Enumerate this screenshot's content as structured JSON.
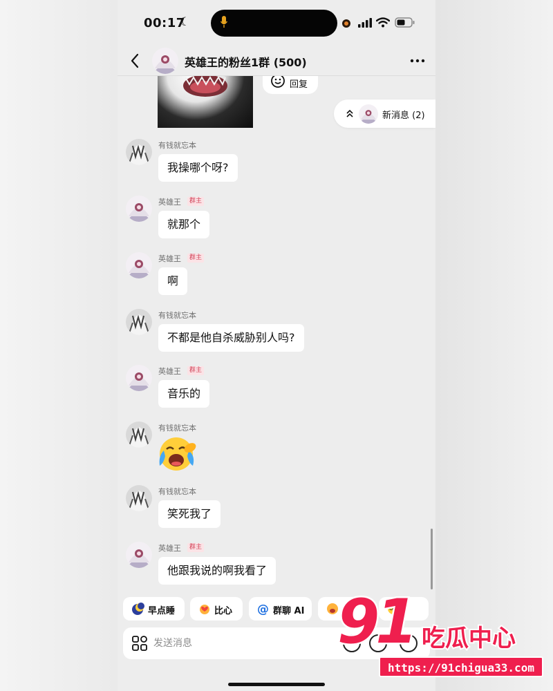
{
  "status_bar": {
    "time": "00:17"
  },
  "header": {
    "title": "英雄王的粉丝1群 (500)"
  },
  "reply_chip": {
    "label": "回复"
  },
  "new_messages": {
    "label": "新消息 (2)"
  },
  "messages": [
    {
      "sender": "有钱就忘本",
      "badge": "",
      "text": "我操哪个呀?"
    },
    {
      "sender": "英雄王",
      "badge": "群主",
      "text": "就那个"
    },
    {
      "sender": "英雄王",
      "badge": "群主",
      "text": "啊"
    },
    {
      "sender": "有钱就忘本",
      "badge": "",
      "text": "不都是他自杀威胁别人吗?"
    },
    {
      "sender": "英雄王",
      "badge": "群主",
      "text": "音乐的"
    },
    {
      "sender": "有钱就忘本",
      "badge": "",
      "text": "",
      "emoji": "crying-laughing-emoji"
    },
    {
      "sender": "有钱就忘本",
      "badge": "",
      "text": "笑死我了"
    },
    {
      "sender": "英雄王",
      "badge": "群主",
      "text": "他跟我说的啊我看了"
    }
  ],
  "quick_actions": [
    "早点睡",
    "比心",
    "群聊 AI",
    "哈"
  ],
  "input": {
    "placeholder": "发送消息"
  },
  "watermark": {
    "number": "91",
    "text": "吃瓜中心",
    "url": "https://91chigua33.com"
  },
  "colors": {
    "accent": "#ef1f4e",
    "badge_text": "#d2455a",
    "badge_bg": "#fbe3e6"
  }
}
